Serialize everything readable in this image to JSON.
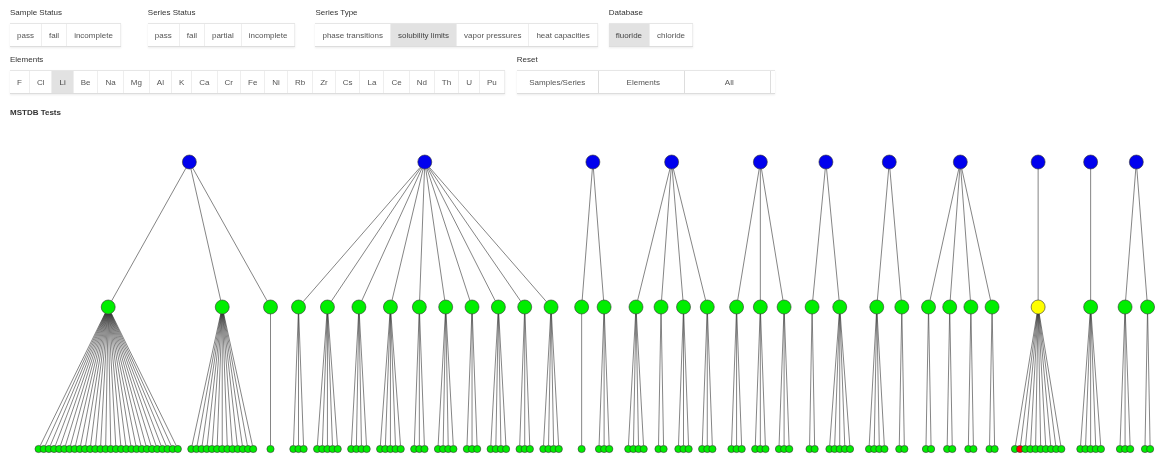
{
  "filters": [
    {
      "label": "Sample Status",
      "kind": "toggle",
      "options": [
        {
          "label": "pass",
          "selected": false
        },
        {
          "label": "fail",
          "selected": false
        },
        {
          "label": "incomplete",
          "selected": false
        }
      ]
    },
    {
      "label": "Series Status",
      "kind": "toggle",
      "options": [
        {
          "label": "pass",
          "selected": false
        },
        {
          "label": "fail",
          "selected": false
        },
        {
          "label": "partial",
          "selected": false
        },
        {
          "label": "incomplete",
          "selected": false
        }
      ]
    },
    {
      "label": "Series Type",
      "kind": "toggle",
      "options": [
        {
          "label": "phase transitions",
          "selected": false
        },
        {
          "label": "solubility limits",
          "selected": true
        },
        {
          "label": "vapor pressures",
          "selected": false
        },
        {
          "label": "heat capacities",
          "selected": false
        }
      ]
    },
    {
      "label": "Database",
      "kind": "toggle",
      "options": [
        {
          "label": "fluoride",
          "selected": true
        },
        {
          "label": "chloride",
          "selected": false
        }
      ]
    }
  ],
  "controls": [
    {
      "label": "Elements",
      "kind": "toggle",
      "options": [
        {
          "label": "F",
          "selected": false
        },
        {
          "label": "Cl",
          "selected": false
        },
        {
          "label": "Li",
          "selected": true
        },
        {
          "label": "Be",
          "selected": false
        },
        {
          "label": "Na",
          "selected": false
        },
        {
          "label": "Mg",
          "selected": false
        },
        {
          "label": "Al",
          "selected": false
        },
        {
          "label": "K",
          "selected": false
        },
        {
          "label": "Ca",
          "selected": false
        },
        {
          "label": "Cr",
          "selected": false
        },
        {
          "label": "Fe",
          "selected": false
        },
        {
          "label": "Ni",
          "selected": false
        },
        {
          "label": "Rb",
          "selected": false
        },
        {
          "label": "Zr",
          "selected": false
        },
        {
          "label": "Cs",
          "selected": false
        },
        {
          "label": "La",
          "selected": false
        },
        {
          "label": "Ce",
          "selected": false
        },
        {
          "label": "Nd",
          "selected": false
        },
        {
          "label": "Th",
          "selected": false
        },
        {
          "label": "U",
          "selected": false
        },
        {
          "label": "Pu",
          "selected": false
        }
      ]
    },
    {
      "label": "Reset",
      "kind": "action",
      "options": [
        {
          "label": "Samples/Series"
        },
        {
          "label": "Elements"
        },
        {
          "label": "All"
        }
      ]
    }
  ],
  "tree": {
    "title": "MSTDB Tests",
    "roots": [
      {
        "color": "#0000ee",
        "children": [
          {
            "color": "#00ee00",
            "children": [
              {
                "color": "#00ee00"
              },
              {
                "color": "#00ee00"
              },
              {
                "color": "#00ee00"
              },
              {
                "color": "#00ee00"
              },
              {
                "color": "#00ee00"
              },
              {
                "color": "#00ee00"
              },
              {
                "color": "#00ee00"
              },
              {
                "color": "#00ee00"
              },
              {
                "color": "#00ee00"
              },
              {
                "color": "#00ee00"
              },
              {
                "color": "#00ee00"
              },
              {
                "color": "#00ee00"
              },
              {
                "color": "#00ee00"
              },
              {
                "color": "#00ee00"
              },
              {
                "color": "#00ee00"
              },
              {
                "color": "#00ee00"
              },
              {
                "color": "#00ee00"
              },
              {
                "color": "#00ee00"
              },
              {
                "color": "#00ee00"
              },
              {
                "color": "#00ee00"
              },
              {
                "color": "#00ee00"
              },
              {
                "color": "#00ee00"
              },
              {
                "color": "#00ee00"
              },
              {
                "color": "#00ee00"
              },
              {
                "color": "#00ee00"
              },
              {
                "color": "#00ee00"
              },
              {
                "color": "#00ee00"
              },
              {
                "color": "#00ee00"
              }
            ]
          },
          {
            "color": "#00ee00",
            "children": [
              {
                "color": "#00ee00"
              },
              {
                "color": "#00ee00"
              },
              {
                "color": "#00ee00"
              },
              {
                "color": "#00ee00"
              },
              {
                "color": "#00ee00"
              },
              {
                "color": "#00ee00"
              },
              {
                "color": "#00ee00"
              },
              {
                "color": "#00ee00"
              },
              {
                "color": "#00ee00"
              },
              {
                "color": "#00ee00"
              },
              {
                "color": "#00ee00"
              },
              {
                "color": "#00ee00"
              },
              {
                "color": "#00ee00"
              }
            ]
          },
          {
            "color": "#00ee00",
            "children": [
              {
                "color": "#00ee00"
              }
            ]
          }
        ]
      },
      {
        "color": "#0000ee",
        "children": [
          {
            "color": "#00ee00",
            "children": [
              {
                "color": "#00ee00"
              },
              {
                "color": "#00ee00"
              },
              {
                "color": "#00ee00"
              }
            ]
          },
          {
            "color": "#00ee00",
            "children": [
              {
                "color": "#00ee00"
              },
              {
                "color": "#00ee00"
              },
              {
                "color": "#00ee00"
              },
              {
                "color": "#00ee00"
              },
              {
                "color": "#00ee00"
              }
            ]
          },
          {
            "color": "#00ee00",
            "children": [
              {
                "color": "#00ee00"
              },
              {
                "color": "#00ee00"
              },
              {
                "color": "#00ee00"
              },
              {
                "color": "#00ee00"
              }
            ]
          },
          {
            "color": "#00ee00",
            "children": [
              {
                "color": "#00ee00"
              },
              {
                "color": "#00ee00"
              },
              {
                "color": "#00ee00"
              },
              {
                "color": "#00ee00"
              },
              {
                "color": "#00ee00"
              }
            ]
          },
          {
            "color": "#00ee00",
            "children": [
              {
                "color": "#00ee00"
              },
              {
                "color": "#00ee00"
              },
              {
                "color": "#00ee00"
              }
            ]
          },
          {
            "color": "#00ee00",
            "children": [
              {
                "color": "#00ee00"
              },
              {
                "color": "#00ee00"
              },
              {
                "color": "#00ee00"
              },
              {
                "color": "#00ee00"
              }
            ]
          },
          {
            "color": "#00ee00",
            "children": [
              {
                "color": "#00ee00"
              },
              {
                "color": "#00ee00"
              },
              {
                "color": "#00ee00"
              }
            ]
          },
          {
            "color": "#00ee00",
            "children": [
              {
                "color": "#00ee00"
              },
              {
                "color": "#00ee00"
              },
              {
                "color": "#00ee00"
              },
              {
                "color": "#00ee00"
              }
            ]
          },
          {
            "color": "#00ee00",
            "children": [
              {
                "color": "#00ee00"
              },
              {
                "color": "#00ee00"
              },
              {
                "color": "#00ee00"
              }
            ]
          },
          {
            "color": "#00ee00",
            "children": [
              {
                "color": "#00ee00"
              },
              {
                "color": "#00ee00"
              },
              {
                "color": "#00ee00"
              },
              {
                "color": "#00ee00"
              }
            ]
          }
        ]
      },
      {
        "color": "#0000ee",
        "children": [
          {
            "color": "#00ee00",
            "children": [
              {
                "color": "#00ee00"
              }
            ]
          },
          {
            "color": "#00ee00",
            "children": [
              {
                "color": "#00ee00"
              },
              {
                "color": "#00ee00"
              },
              {
                "color": "#00ee00"
              }
            ]
          }
        ]
      },
      {
        "color": "#0000ee",
        "children": [
          {
            "color": "#00ee00",
            "children": [
              {
                "color": "#00ee00"
              },
              {
                "color": "#00ee00"
              },
              {
                "color": "#00ee00"
              },
              {
                "color": "#00ee00"
              }
            ]
          },
          {
            "color": "#00ee00",
            "children": [
              {
                "color": "#00ee00"
              },
              {
                "color": "#00ee00"
              }
            ]
          },
          {
            "color": "#00ee00",
            "children": [
              {
                "color": "#00ee00"
              },
              {
                "color": "#00ee00"
              },
              {
                "color": "#00ee00"
              }
            ]
          },
          {
            "color": "#00ee00",
            "children": [
              {
                "color": "#00ee00"
              },
              {
                "color": "#00ee00"
              },
              {
                "color": "#00ee00"
              }
            ]
          }
        ]
      },
      {
        "color": "#0000ee",
        "children": [
          {
            "color": "#00ee00",
            "children": [
              {
                "color": "#00ee00"
              },
              {
                "color": "#00ee00"
              },
              {
                "color": "#00ee00"
              }
            ]
          },
          {
            "color": "#00ee00",
            "children": [
              {
                "color": "#00ee00"
              },
              {
                "color": "#00ee00"
              },
              {
                "color": "#00ee00"
              }
            ]
          },
          {
            "color": "#00ee00",
            "children": [
              {
                "color": "#00ee00"
              },
              {
                "color": "#00ee00"
              },
              {
                "color": "#00ee00"
              }
            ]
          }
        ]
      },
      {
        "color": "#0000ee",
        "children": [
          {
            "color": "#00ee00",
            "children": [
              {
                "color": "#00ee00"
              },
              {
                "color": "#00ee00"
              }
            ]
          },
          {
            "color": "#00ee00",
            "children": [
              {
                "color": "#00ee00"
              },
              {
                "color": "#00ee00"
              },
              {
                "color": "#00ee00"
              },
              {
                "color": "#00ee00"
              },
              {
                "color": "#00ee00"
              }
            ]
          }
        ]
      },
      {
        "color": "#0000ee",
        "children": [
          {
            "color": "#00ee00",
            "children": [
              {
                "color": "#00ee00"
              },
              {
                "color": "#00ee00"
              },
              {
                "color": "#00ee00"
              },
              {
                "color": "#00ee00"
              }
            ]
          },
          {
            "color": "#00ee00",
            "children": [
              {
                "color": "#00ee00"
              },
              {
                "color": "#00ee00"
              }
            ]
          }
        ]
      },
      {
        "color": "#0000ee",
        "children": [
          {
            "color": "#00ee00",
            "children": [
              {
                "color": "#00ee00"
              },
              {
                "color": "#00ee00"
              }
            ]
          },
          {
            "color": "#00ee00",
            "children": [
              {
                "color": "#00ee00"
              },
              {
                "color": "#00ee00"
              }
            ]
          },
          {
            "color": "#00ee00",
            "children": [
              {
                "color": "#00ee00"
              },
              {
                "color": "#00ee00"
              }
            ]
          },
          {
            "color": "#00ee00",
            "children": [
              {
                "color": "#00ee00"
              },
              {
                "color": "#00ee00"
              }
            ]
          }
        ]
      },
      {
        "color": "#0000ee",
        "children": [
          {
            "color": "#ffff00",
            "children": [
              {
                "color": "#00ee00"
              },
              {
                "color": "#ff0000"
              },
              {
                "color": "#00ee00"
              },
              {
                "color": "#00ee00"
              },
              {
                "color": "#00ee00"
              },
              {
                "color": "#00ee00"
              },
              {
                "color": "#00ee00"
              },
              {
                "color": "#00ee00"
              },
              {
                "color": "#00ee00"
              },
              {
                "color": "#00ee00"
              }
            ]
          }
        ]
      },
      {
        "color": "#0000ee",
        "children": [
          {
            "color": "#00ee00",
            "children": [
              {
                "color": "#00ee00"
              },
              {
                "color": "#00ee00"
              },
              {
                "color": "#00ee00"
              },
              {
                "color": "#00ee00"
              },
              {
                "color": "#00ee00"
              }
            ]
          }
        ]
      },
      {
        "color": "#0000ee",
        "children": [
          {
            "color": "#00ee00",
            "children": [
              {
                "color": "#00ee00"
              },
              {
                "color": "#00ee00"
              },
              {
                "color": "#00ee00"
              }
            ]
          },
          {
            "color": "#00ee00",
            "children": [
              {
                "color": "#00ee00"
              },
              {
                "color": "#00ee00"
              }
            ]
          }
        ]
      }
    ]
  }
}
